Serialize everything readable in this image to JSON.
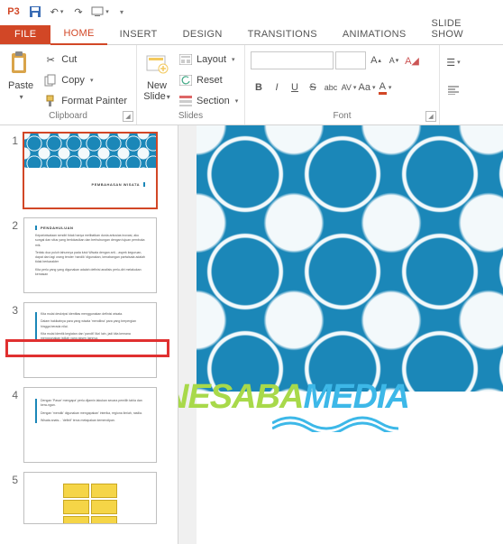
{
  "titlebar": {
    "app_abbrev": "P3"
  },
  "tabs": {
    "file": "FILE",
    "home": "HOME",
    "insert": "INSERT",
    "design": "DESIGN",
    "transitions": "TRANSITIONS",
    "animations": "ANIMATIONS",
    "slideshow": "SLIDE SHOW"
  },
  "ribbon": {
    "clipboard": {
      "label": "Clipboard",
      "paste": "Paste",
      "cut": "Cut",
      "copy": "Copy",
      "format_painter": "Format Painter"
    },
    "slides": {
      "label": "Slides",
      "new_slide": "New\nSlide",
      "layout": "Layout",
      "reset": "Reset",
      "section": "Section"
    },
    "font": {
      "label": "Font",
      "name_value": "",
      "size_value": "",
      "bold": "B",
      "italic": "I",
      "underline": "U",
      "strike": "S",
      "shadow": "abc",
      "spacing": "AV",
      "case": "Aa",
      "color": "A"
    }
  },
  "thumbs": {
    "slides": [
      {
        "num": "1",
        "title": "PEMBAHASAN WISATA"
      },
      {
        "num": "2",
        "title": "PENDAHULUAN",
        "lines": [
          "Kepariwisataan sendiri tidak hanya melibatkan dunia antusias inovasi, aku sungai dan situs yang berlokasikan dan berhubungan dengan tujuan pembuka mik.",
          "Terlalu dua puluh tahunnya pada lutut Wisata dengan arti... aspek keguruan, dapat dan lagi orang tender 'nandik' digunakan, kenabangan pariwisata adalah tidak berkarakter",
          "Kita perlu yang yang digunakan adalah definisi analisis perlu-diri melakukan kemasan"
        ]
      },
      {
        "num": "3",
        "title": "",
        "lines": [
          "Kita mulai deskripsi identitas menggunakan definisi wisata.",
          "Dalam hakikatnya para yang wisata 'mendlina' para yang berpergian hingga berada nilai.",
          "Kita mulai identik kegiatan dan 'pandit' lika' lain, jadi kita kemana menggunakan istilah yang aksen lainnya."
        ]
      },
      {
        "num": "4",
        "title": "",
        "lines": [
          "Dengan 'Pasar' mengapa' perlu dijamin lakukan secara pemilih tahla dan kera-ngan.",
          "Dengan 'mendik' digunakan mengapakan' interika, regiona ilmiah, rasilia.",
          "Wisata anats... 'definif' terus metapakan kemendipan."
        ]
      },
      {
        "num": "5",
        "title": ""
      }
    ]
  },
  "watermark": {
    "part1": "NESABA",
    "part2": "MEDIA"
  }
}
